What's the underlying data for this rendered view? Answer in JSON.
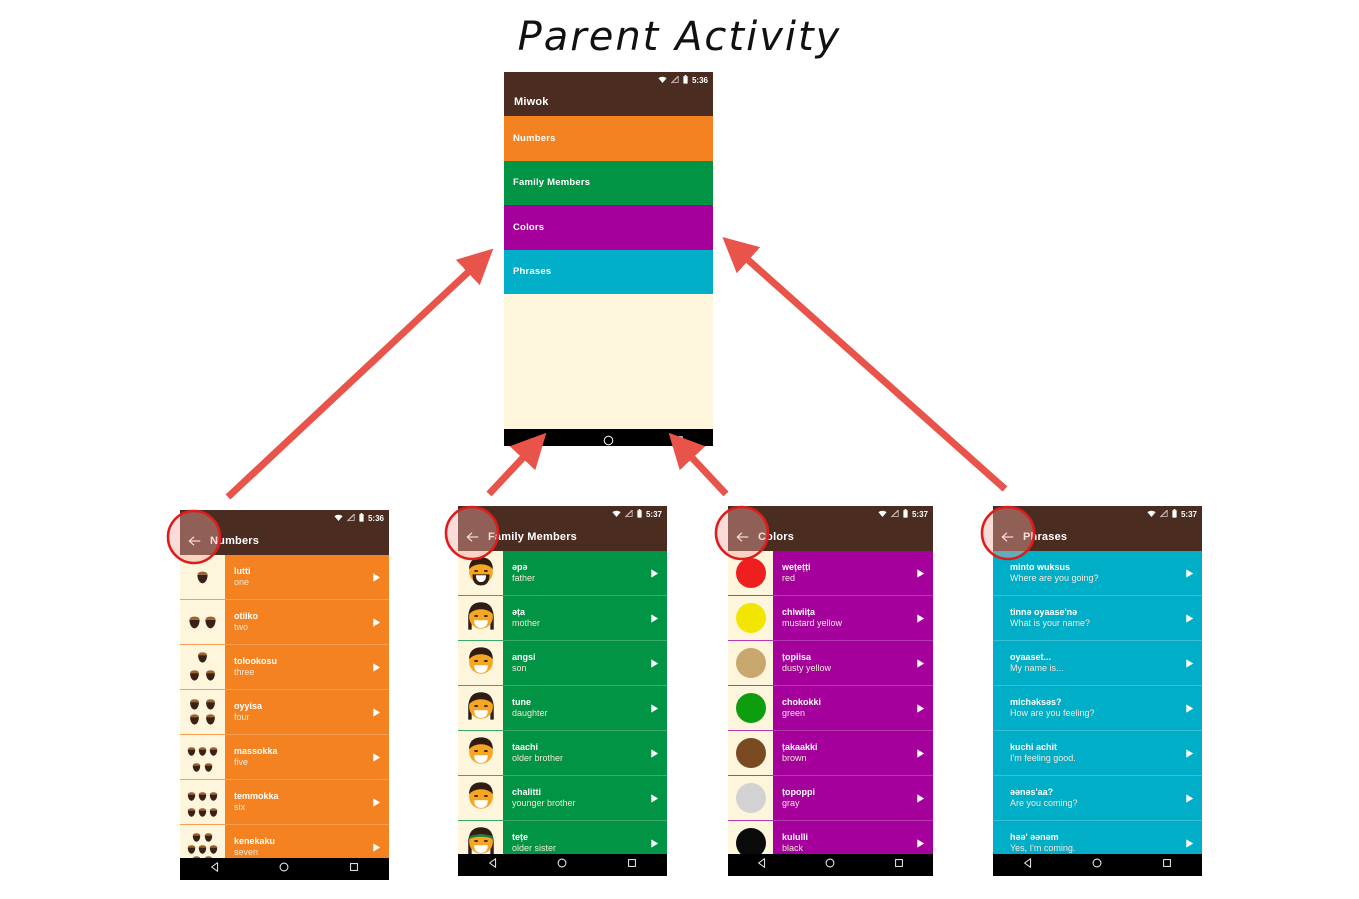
{
  "page": {
    "title": "Parent Activity",
    "annotation_color": "#e8534a",
    "highlight_circle_color": "#e01b1b"
  },
  "parent_phone": {
    "name": "MiwokActivity",
    "status": {
      "time": "5:36",
      "icons": [
        "wifi-icon",
        "signal-off-icon",
        "battery-icon"
      ]
    },
    "appbar": {
      "title": "Miwok",
      "has_back": false
    },
    "appbar_color": "#4a2c21",
    "categories": [
      {
        "label": "Numbers",
        "color": "#f58220"
      },
      {
        "label": "Family Members",
        "color": "#009444"
      },
      {
        "label": "Colors",
        "color": "#a5009c"
      },
      {
        "label": "Phrases",
        "color": "#00aec7"
      }
    ],
    "empty_color": "#fdf5dc",
    "nav": [
      "back-nav-icon",
      "home-nav-icon",
      "recents-nav-icon"
    ]
  },
  "child_phones": [
    {
      "name": "NumbersActivity",
      "status": {
        "time": "5:36"
      },
      "appbar": {
        "title": "Numbers"
      },
      "accent": "#f58220",
      "image_type": "acorn",
      "rows": [
        {
          "miwok": "lutti",
          "translation": "one",
          "count": 1
        },
        {
          "miwok": "otiiko",
          "translation": "two",
          "count": 2
        },
        {
          "miwok": "tolookosu",
          "translation": "three",
          "count": 3
        },
        {
          "miwok": "oyyisa",
          "translation": "four",
          "count": 4
        },
        {
          "miwok": "massokka",
          "translation": "five",
          "count": 5
        },
        {
          "miwok": "temmokka",
          "translation": "six",
          "count": 6
        },
        {
          "miwok": "kenekaku",
          "translation": "seven",
          "count": 7
        }
      ]
    },
    {
      "name": "FamilyActivity",
      "status": {
        "time": "5:37"
      },
      "appbar": {
        "title": "Family Members"
      },
      "accent": "#009444",
      "image_type": "face",
      "rows": [
        {
          "miwok": "əpə",
          "translation": "father",
          "face": "father"
        },
        {
          "miwok": "əṭa",
          "translation": "mother",
          "face": "mother"
        },
        {
          "miwok": "angsi",
          "translation": "son",
          "face": "son"
        },
        {
          "miwok": "tune",
          "translation": "daughter",
          "face": "daughter"
        },
        {
          "miwok": "taachi",
          "translation": "older brother",
          "face": "older-brother"
        },
        {
          "miwok": "chalitti",
          "translation": "younger brother",
          "face": "younger-brother"
        },
        {
          "miwok": "teṭe",
          "translation": "older sister",
          "face": "older-sister"
        }
      ]
    },
    {
      "name": "ColorsActivity",
      "status": {
        "time": "5:37"
      },
      "appbar": {
        "title": "Colors"
      },
      "accent": "#a5009c",
      "image_type": "swatch",
      "rows": [
        {
          "miwok": "weṭeṭṭi",
          "translation": "red",
          "swatch": "#f01f1f"
        },
        {
          "miwok": "chiwiiṭa",
          "translation": "mustard yellow",
          "swatch": "#f2e600"
        },
        {
          "miwok": "ṭopiisa",
          "translation": "dusty yellow",
          "swatch": "#c9a86f"
        },
        {
          "miwok": "chokokki",
          "translation": "green",
          "swatch": "#0d9e10"
        },
        {
          "miwok": "ṭakaakki",
          "translation": "brown",
          "swatch": "#7a4a22"
        },
        {
          "miwok": "ṭopoppi",
          "translation": "gray",
          "swatch": "#d2d2d2"
        },
        {
          "miwok": "kululli",
          "translation": "black",
          "swatch": "#0a0a0a"
        }
      ]
    },
    {
      "name": "PhrasesActivity",
      "status": {
        "time": "5:37"
      },
      "appbar": {
        "title": "Phrases"
      },
      "accent": "#00aec7",
      "image_type": "none",
      "rows": [
        {
          "miwok": "minto wuksus",
          "translation": "Where are you going?"
        },
        {
          "miwok": "tinnə oyaase'nə",
          "translation": "What is your name?"
        },
        {
          "miwok": "oyaaset...",
          "translation": "My name is..."
        },
        {
          "miwok": "michəksəs?",
          "translation": "How are you feeling?"
        },
        {
          "miwok": "kuchi achit",
          "translation": "I'm feeling good."
        },
        {
          "miwok": "əənəs'aa?",
          "translation": "Are you coming?"
        },
        {
          "miwok": "həə' əənəm",
          "translation": "Yes, I'm coming."
        }
      ]
    }
  ]
}
